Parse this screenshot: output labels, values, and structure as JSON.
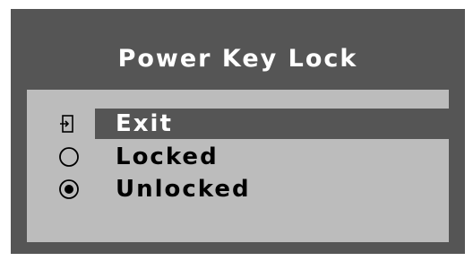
{
  "window": {
    "title": "Power Key Lock"
  },
  "menu": {
    "items": [
      {
        "label": "Exit",
        "icon": "exit-icon",
        "selected": true
      },
      {
        "label": "Locked",
        "icon": "radio-empty-icon",
        "checked": false
      },
      {
        "label": "Unlocked",
        "icon": "radio-filled-icon",
        "checked": true
      }
    ]
  },
  "colors": {
    "frame": "#555555",
    "panel": "#bcbcbc",
    "highlight": "#555555",
    "text_dark": "#000000",
    "text_light": "#ffffff"
  }
}
